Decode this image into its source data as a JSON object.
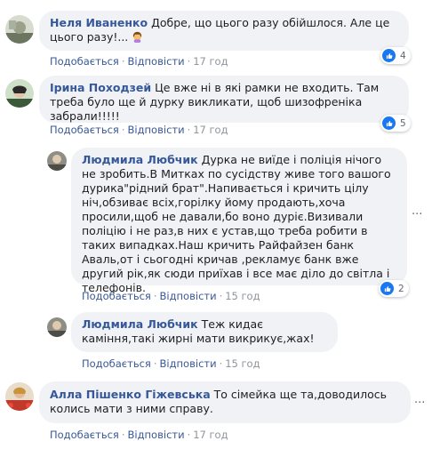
{
  "comments": [
    {
      "author": "Неля Иваненко",
      "text": "Добре, що цього разу обійшлося. Але це цього разу!...",
      "like_label": "Подобається",
      "reply_label": "Відповісти",
      "time": "17 год",
      "reactions": "4"
    },
    {
      "author": "Ірина Походзей",
      "text": "Це вже ні в які рамки не входить. Там треба було ще й дурку викликати, щоб шизофреніка забрали!!!!!",
      "like_label": "Подобається",
      "reply_label": "Відповісти",
      "time": "17 год",
      "reactions": "5"
    },
    {
      "author": "Людмила Любчик",
      "text": "Дурка не виїде і поліція нічого не зробить.В Митках по сусідству живе того вашого дурика\"рідний брат\".Напивається і кричить цілу ніч,обзиває всіх,горілку йому продають,хоча просили,щоб не давали,бо воно дуріє.Визивали поліцію і не раз,в них є устав,що треба робити в таких випадках.Наш кричить Райфайзен банк Аваль,от і сьогодні кричав ,рекламує банк вже другий рік,як сюди приїхав і все має діло до світла і телефонів.",
      "like_label": "Подобається",
      "reply_label": "Відповісти",
      "time": "15 год",
      "reactions": "2"
    },
    {
      "author": "Людмила Любчик",
      "text": "Теж кидає каміння,такі жирні мати викрикує,жах!",
      "like_label": "Подобається",
      "reply_label": "Відповісти",
      "time": "15 год"
    },
    {
      "author": "Алла Пішенко Гіжевська",
      "text": "То сімейка ще та,доводилось колись мати з ними справу.",
      "like_label": "Подобається",
      "reply_label": "Відповісти",
      "time": "17 год"
    }
  ],
  "colors": {
    "link": "#365899",
    "bubble": "#f0f2f5",
    "like": "#1877f2",
    "meta": "#90949c"
  },
  "icons": {
    "like": "thumbs-up-icon",
    "emoji": "woman-gesturing-emoji",
    "more": "more-options-icon"
  }
}
